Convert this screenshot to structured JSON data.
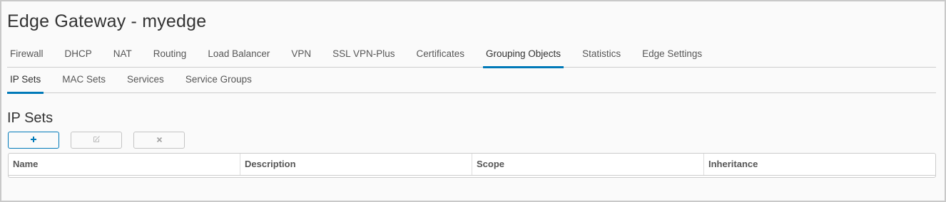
{
  "page": {
    "title": "Edge Gateway - myedge"
  },
  "tabs": [
    {
      "label": "Firewall",
      "active": false
    },
    {
      "label": "DHCP",
      "active": false
    },
    {
      "label": "NAT",
      "active": false
    },
    {
      "label": "Routing",
      "active": false
    },
    {
      "label": "Load Balancer",
      "active": false
    },
    {
      "label": "VPN",
      "active": false
    },
    {
      "label": "SSL VPN-Plus",
      "active": false
    },
    {
      "label": "Certificates",
      "active": false
    },
    {
      "label": "Grouping Objects",
      "active": true
    },
    {
      "label": "Statistics",
      "active": false
    },
    {
      "label": "Edge Settings",
      "active": false
    }
  ],
  "subtabs": [
    {
      "label": "IP Sets",
      "active": true
    },
    {
      "label": "MAC Sets",
      "active": false
    },
    {
      "label": "Services",
      "active": false
    },
    {
      "label": "Service Groups",
      "active": false
    }
  ],
  "section": {
    "title": "IP Sets"
  },
  "toolbar": {
    "add": {
      "icon": "plus-icon",
      "enabled": true
    },
    "edit": {
      "icon": "edit-icon",
      "enabled": false
    },
    "delete": {
      "icon": "close-icon",
      "enabled": false
    }
  },
  "table": {
    "columns": [
      "Name",
      "Description",
      "Scope",
      "Inheritance"
    ],
    "rows": []
  },
  "colors": {
    "accent": "#0079b8",
    "text": "#565656",
    "border": "#cccccc",
    "disabled": "#c4c4c4"
  }
}
